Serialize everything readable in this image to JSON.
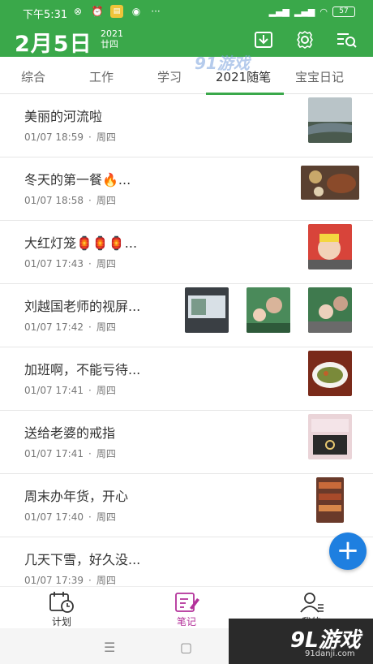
{
  "status_bar": {
    "time": "下午5:31",
    "battery": "57"
  },
  "header": {
    "date": "2月5日",
    "year": "2021",
    "lunar": "廿四"
  },
  "tabs": [
    {
      "label": "综合"
    },
    {
      "label": "工作"
    },
    {
      "label": "学习"
    },
    {
      "label": "2021随笔"
    },
    {
      "label": "宝宝日记"
    }
  ],
  "notes": [
    {
      "title": "美丽的河流啦",
      "date": "01/07 18:59",
      "weekday": "周四"
    },
    {
      "title": "冬天的第一餐🔥...",
      "date": "01/07 18:58",
      "weekday": "周四"
    },
    {
      "title": "大红灯笼🏮🏮🏮...",
      "date": "01/07 17:43",
      "weekday": "周四"
    },
    {
      "title": "刘越国老师的视屏...",
      "date": "01/07 17:42",
      "weekday": "周四"
    },
    {
      "title": "加班啊，不能亏待...",
      "date": "01/07 17:41",
      "weekday": "周四"
    },
    {
      "title": "送给老婆的戒指",
      "date": "01/07 17:41",
      "weekday": "周四"
    },
    {
      "title": "周末办年货，开心",
      "date": "01/07 17:40",
      "weekday": "周四"
    },
    {
      "title": "几天下雪，好久没...",
      "date": "01/07 17:39",
      "weekday": "周四"
    }
  ],
  "fab_label": "+",
  "bottom_nav": [
    {
      "label": "计划"
    },
    {
      "label": "笔记"
    },
    {
      "label": "我的"
    }
  ],
  "watermark": {
    "top": "91游戏",
    "big": "9L游戏",
    "small": "91danji.com"
  },
  "colors": {
    "brand_green": "#3aa84a",
    "fab_blue": "#1e7fe0",
    "active_nav": "#b3319a"
  }
}
